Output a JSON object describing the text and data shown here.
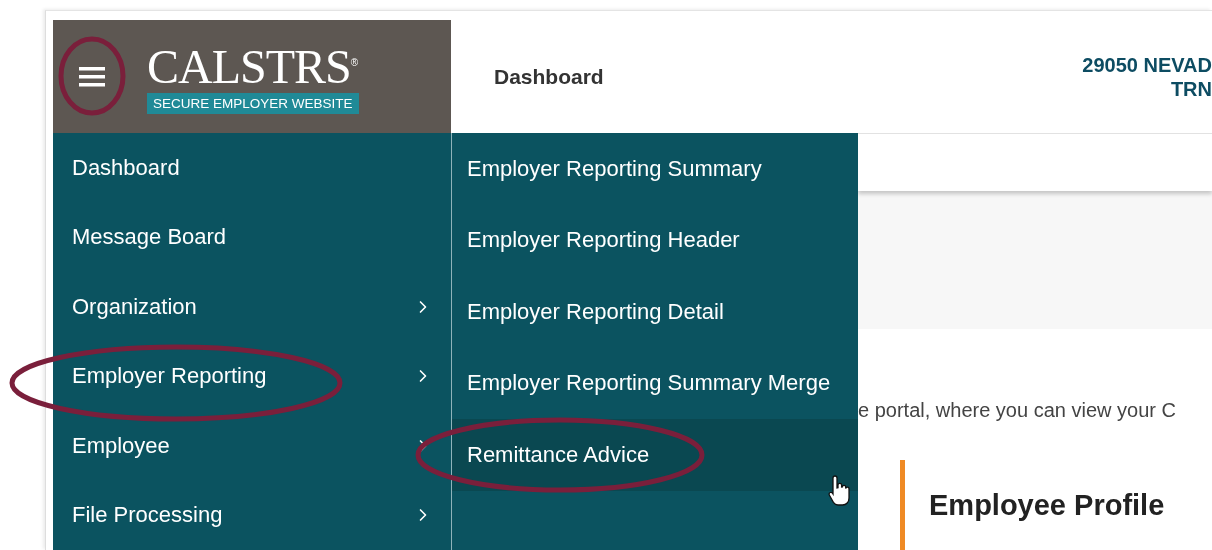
{
  "header": {
    "menu_button": {
      "annotated": true
    },
    "logo": {
      "name": "CALSTRS$^{®}$",
      "tagline": "SECURE EMPLOYER WEBSITE"
    },
    "title": "Dashboard",
    "organization": [
      "29050 NEVAD",
      "TRN"
    ]
  },
  "menu": {
    "items": [
      {
        "label": "Dashboard",
        "has_submenu": false,
        "annotated": false
      },
      {
        "label": "Message Board",
        "has_submenu": false,
        "annotated": false
      },
      {
        "label": "Organization",
        "has_submenu": true,
        "annotated": false
      },
      {
        "label": "Employer Reporting",
        "has_submenu": true,
        "annotated": true
      },
      {
        "label": "Employee",
        "has_submenu": true,
        "annotated": false
      },
      {
        "label": "File Processing",
        "has_submenu": true,
        "annotated": false
      }
    ]
  },
  "submenu": {
    "items": [
      {
        "label": "Employer Reporting Summary",
        "hovered": false,
        "annotated": false
      },
      {
        "label": "Employer Reporting Header",
        "hovered": false,
        "annotated": false
      },
      {
        "label": "Employer Reporting Detail",
        "hovered": false,
        "annotated": false
      },
      {
        "label": "Employer Reporting Summary Merge",
        "hovered": false,
        "annotated": false
      },
      {
        "label": "Remittance Advice",
        "hovered": true,
        "annotated": true
      }
    ]
  },
  "content": {
    "intro": "e portal, where you can view your C",
    "section_title": "Employee Profile"
  }
}
